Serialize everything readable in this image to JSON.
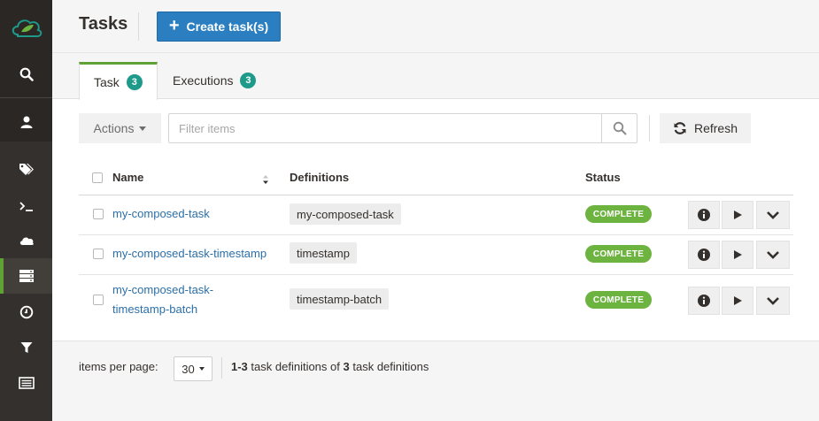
{
  "header": {
    "title": "Tasks",
    "create_label": "Create task(s)"
  },
  "sidebar": {
    "items": [
      {
        "icon": "search-icon"
      },
      {
        "icon": "user-icon"
      },
      {
        "icon": "tags-icon"
      },
      {
        "icon": "terminal-icon"
      },
      {
        "icon": "cloud-icon"
      },
      {
        "icon": "server-icon",
        "active": true
      },
      {
        "icon": "clock-icon"
      },
      {
        "icon": "filter-icon"
      },
      {
        "icon": "list-icon"
      }
    ]
  },
  "tabs": [
    {
      "label": "Task",
      "count": "3",
      "active": true
    },
    {
      "label": "Executions",
      "count": "3",
      "active": false
    }
  ],
  "toolbar": {
    "actions_label": "Actions",
    "filter_placeholder": "Filter items",
    "refresh_label": "Refresh"
  },
  "table": {
    "headers": {
      "name": "Name",
      "definitions": "Definitions",
      "status": "Status"
    },
    "rows": [
      {
        "name": "my-composed-task",
        "definition": "my-composed-task",
        "status": "COMPLETE"
      },
      {
        "name": "my-composed-task-timestamp",
        "definition": "timestamp",
        "status": "COMPLETE"
      },
      {
        "name_line1": "my-composed-task-",
        "name_line2": "timestamp-batch",
        "definition": "timestamp-batch",
        "status": "COMPLETE"
      }
    ]
  },
  "footer": {
    "items_per_page_label": "items per page:",
    "items_per_page_value": "30",
    "range": "1-3",
    "middle": "task definitions of",
    "total": "3",
    "suffix": "task definitions"
  },
  "colors": {
    "sidebar": "#34302d",
    "accent_green": "#6db33f",
    "primary_blue": "#2b7fc0",
    "badge_teal": "#1d9a8a",
    "link": "#2b6fa9"
  }
}
